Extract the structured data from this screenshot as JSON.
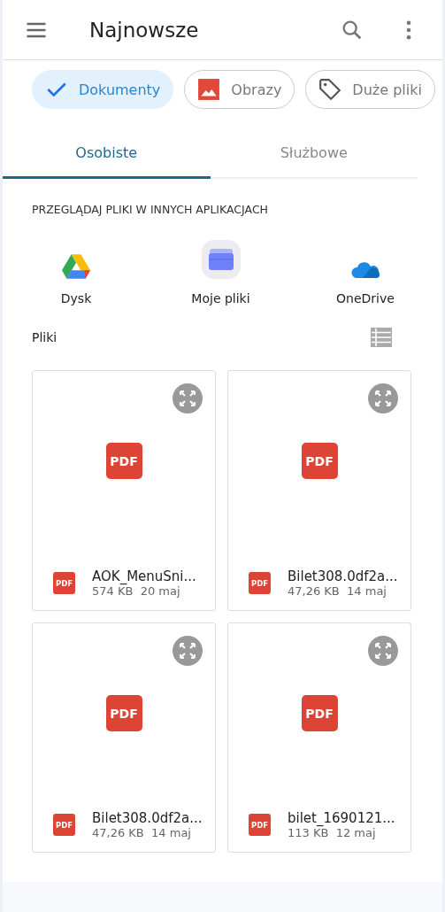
{
  "app_bar": {
    "title": "Najnowsze"
  },
  "chips": [
    {
      "label": "Dokumenty",
      "kind": "check",
      "selected": true
    },
    {
      "label": "Obrazy",
      "kind": "image",
      "selected": false
    },
    {
      "label": "Duże pliki",
      "kind": "tag",
      "selected": false
    }
  ],
  "tabs": [
    {
      "label": "Osobiste",
      "selected": true
    },
    {
      "label": "Służbowe",
      "selected": false
    }
  ],
  "browse_section": {
    "title": "PRZEGLĄDAJ PLIKI W INNYCH APLIKACJACH",
    "apps": [
      {
        "label": "Dysk",
        "kind": "drive"
      },
      {
        "label": "Moje pliki",
        "kind": "myfiles"
      },
      {
        "label": "OneDrive",
        "kind": "cloud"
      }
    ]
  },
  "files_section": {
    "title": "Pliki"
  },
  "files": [
    {
      "name": "AOK_MenuSni...",
      "meta": "574 KB  20 maj",
      "thumb_label": "PDF",
      "icon_label": "PDF"
    },
    {
      "name": "Bilet308.0df2a...",
      "meta": "47,26 KB  14 maj",
      "thumb_label": "PDF",
      "icon_label": "PDF"
    },
    {
      "name": "Bilet308.0df2a...",
      "meta": "47,26 KB  14 maj",
      "thumb_label": "PDF",
      "icon_label": "PDF"
    },
    {
      "name": "bilet_1690121...",
      "meta": "113 KB  12 maj",
      "thumb_label": "PDF",
      "icon_label": "PDF"
    }
  ]
}
